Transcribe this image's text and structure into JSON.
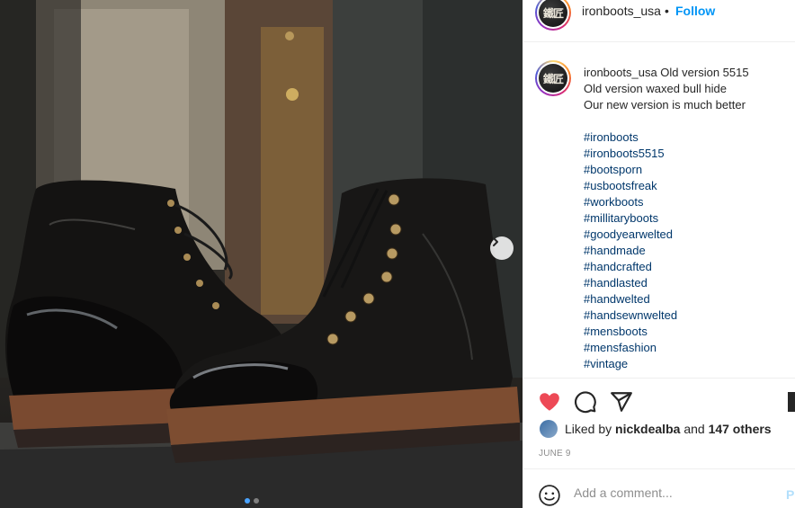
{
  "post": {
    "username": "ironboots_usa",
    "follow_label": "Follow",
    "separator": "•",
    "avatar_icon": "ironboots-logo-icon",
    "photo_alt": "Old version 5515 waxed bull hide boots"
  },
  "caption": {
    "username": "ironboots_usa",
    "lines": [
      "Old version 5515",
      "Old version waxed bull hide",
      "Our new version is much better"
    ],
    "hashtags": [
      "#ironboots",
      "#ironboots5515",
      "#bootsporn",
      "#usbootsfreak",
      "#workboots",
      "#millitaryboots",
      "#goodyearwelted",
      "#handmade",
      "#handcrafted",
      "#handlasted",
      "#handwelted",
      "#handsewnwelted",
      "#mensboots",
      "#mensfashion",
      "#vintage"
    ]
  },
  "actions": {
    "like_icon": "heart-filled-icon",
    "comment_icon": "comment-icon",
    "share_icon": "share-icon",
    "save_icon": "bookmark-icon",
    "like_color": "#ed4956"
  },
  "likes": {
    "prefix": "Liked by",
    "user": "nickdealba",
    "and": "and",
    "others": "147 others"
  },
  "date": "JUNE 9",
  "comment_box": {
    "placeholder": "Add a comment...",
    "post_label": "Post"
  },
  "carousel": {
    "slides": 2,
    "active": 1,
    "next_icon": "chevron-right-icon"
  }
}
